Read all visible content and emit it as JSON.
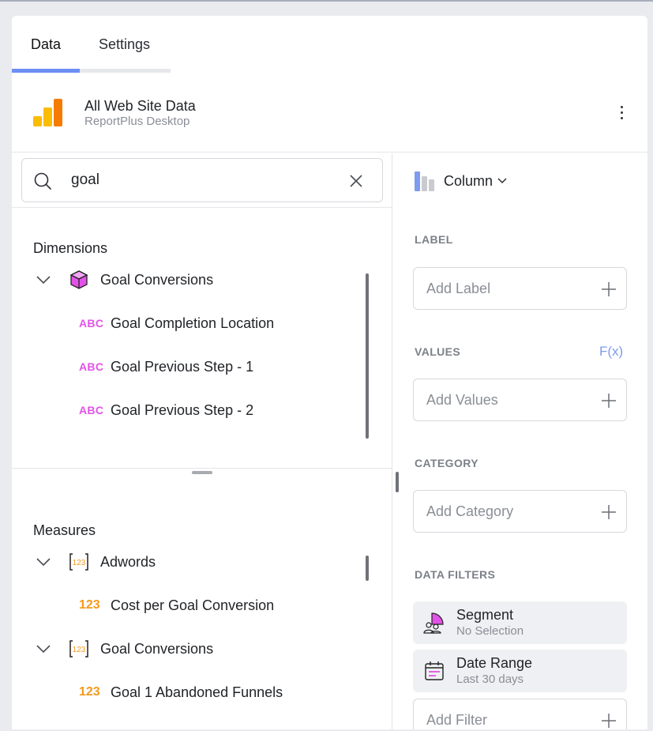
{
  "tabs": [
    {
      "label": "Data",
      "active": true
    },
    {
      "label": "Settings",
      "active": false
    }
  ],
  "source": {
    "title": "All Web Site Data",
    "subtitle": "ReportPlus Desktop"
  },
  "search": {
    "value": "goal",
    "placeholder": ""
  },
  "dimensions": {
    "title": "Dimensions",
    "groups": [
      {
        "label": "Goal Conversions",
        "icon": "cube-icon",
        "items": [
          {
            "type": "ABC",
            "label": "Goal Completion Location"
          },
          {
            "type": "ABC",
            "label": "Goal Previous Step - 1"
          },
          {
            "type": "ABC",
            "label": "Goal Previous Step - 2"
          }
        ]
      }
    ]
  },
  "measures": {
    "title": "Measures",
    "groups": [
      {
        "label": "Adwords",
        "icon": "123",
        "items": [
          {
            "type": "123",
            "label": "Cost per Goal Conversion"
          }
        ]
      },
      {
        "label": "Goal Conversions",
        "icon": "123",
        "items": [
          {
            "type": "123",
            "label": "Goal 1 Abandoned Funnels"
          }
        ]
      }
    ]
  },
  "visualization": {
    "label": "Column"
  },
  "fields": {
    "label_caption": "LABEL",
    "label_placeholder": "Add Label",
    "values_caption": "VALUES",
    "fx_label": "F(x)",
    "values_placeholder": "Add Values",
    "category_caption": "CATEGORY",
    "category_placeholder": "Add Category",
    "filters_caption": "DATA FILTERS",
    "filter_placeholder": "Add Filter"
  },
  "filters": [
    {
      "title": "Segment",
      "subtitle": "No Selection",
      "icon": "segment-icon"
    },
    {
      "title": "Date Range",
      "subtitle": "Last 30 days",
      "icon": "calendar-icon"
    }
  ],
  "colors": {
    "accent": "#6d8ff2",
    "abc": "#e352e8",
    "numeric": "#f39a1a",
    "ga_orange": "#f57c00",
    "ga_yellow": "#fbbc04"
  }
}
